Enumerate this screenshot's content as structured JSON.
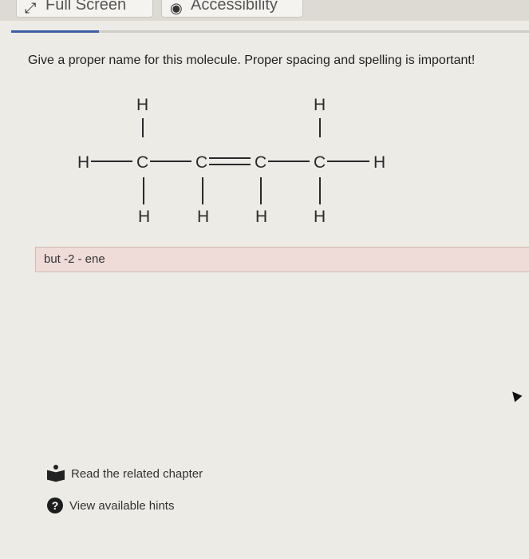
{
  "toolbar": {
    "fullscreen_label": "Full Screen",
    "accessibility_label": "Accessibility"
  },
  "progress": {
    "fraction": 0.17
  },
  "question": {
    "text": "Give a proper name for this molecule. Proper spacing and spelling is important!"
  },
  "molecule": {
    "atoms": [
      "H",
      "H",
      "H",
      "C",
      "C",
      "C",
      "C",
      "H",
      "H",
      "H",
      "H",
      "H"
    ]
  },
  "answer": {
    "value": "but -2 - ene"
  },
  "links": {
    "chapter_label": "Read the related chapter",
    "hints_label": "View available hints",
    "hint_icon_glyph": "?"
  }
}
